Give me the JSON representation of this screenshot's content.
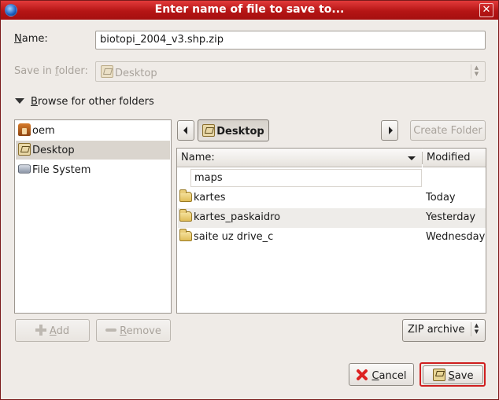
{
  "window": {
    "title": "Enter name of file to save to..."
  },
  "name_field": {
    "label": "Name:",
    "label_u": "N",
    "label_rest": "ame:",
    "value": "biotopi_2004_v3.shp.zip"
  },
  "save_in": {
    "label_pre": "Save in ",
    "label_u": "f",
    "label_rest": "older:",
    "value": "Desktop"
  },
  "browse": {
    "label_pre": "",
    "label_u": "B",
    "label_rest": "rowse for other folders"
  },
  "places": [
    {
      "label": "oem",
      "icon": "home-folder-icon"
    },
    {
      "label": "Desktop",
      "icon": "desktop-icon",
      "selected": true
    },
    {
      "label": "File System",
      "icon": "drive-icon"
    }
  ],
  "path_bar": {
    "current": "Desktop",
    "create_folder": "Create Folder"
  },
  "file_list": {
    "columns": {
      "name": "Name:",
      "modified": "Modified"
    },
    "edit_value": "maps",
    "rows": [
      {
        "name": "kartes",
        "modified": "Today"
      },
      {
        "name": "kartes_paskaidro",
        "modified": "Yesterday"
      },
      {
        "name": "saite uz drive_c",
        "modified": "Wednesday"
      }
    ]
  },
  "places_buttons": {
    "add_u": "A",
    "add_rest": "dd",
    "remove_u": "R",
    "remove_rest": "emove"
  },
  "filter": {
    "value": "ZIP archive"
  },
  "actions": {
    "cancel_u": "C",
    "cancel_rest": "ancel",
    "save_u": "S",
    "save_rest": "ave"
  },
  "colors": {
    "titlebar": "#c21a1a",
    "accent_ring": "#cf1f1f",
    "background": "#efebe7"
  }
}
